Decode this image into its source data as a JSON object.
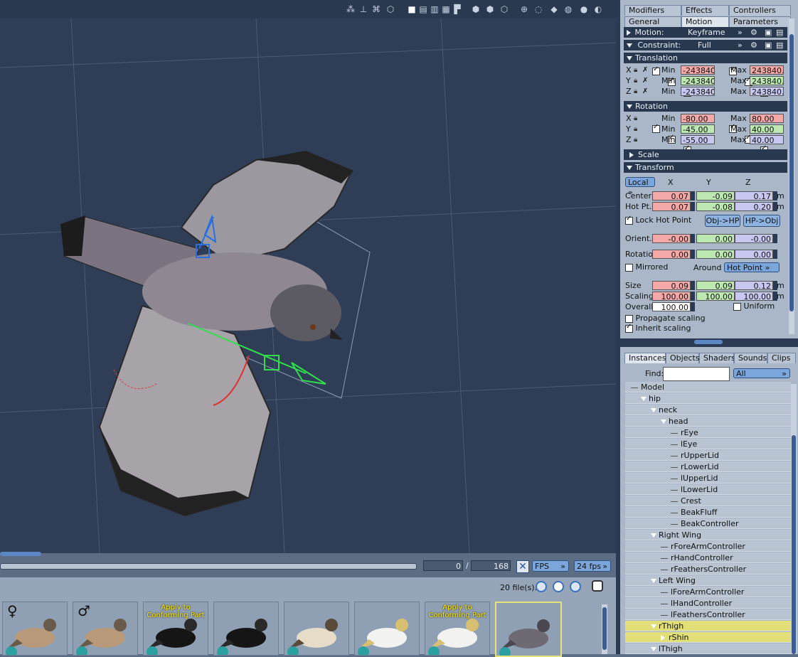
{
  "viewport": {
    "toolbar_icons": [
      "joint-icon",
      "sliders-icon",
      "wire-icon",
      "hexagon-icon",
      "single-view-icon",
      "two-view-icon",
      "three-view-icon",
      "four-view-icon",
      "corner-view-icon",
      "cube-wire-icon",
      "cube-shaded-icon",
      "cube-outline-icon",
      "move-icon",
      "dotted-sphere-icon",
      "box-icon",
      "gray-sphere-icon",
      "shaded-sphere-icon"
    ]
  },
  "params": {
    "top_tabs": [
      "Modifiers",
      "Effects",
      "Controllers"
    ],
    "sub_tabs": [
      "General",
      "Motion",
      "Parameters"
    ],
    "motion": {
      "label": "Motion:",
      "value": "Keyframe"
    },
    "constraint": {
      "label": "Constraint:",
      "value": "Full"
    },
    "translation": {
      "title": "Translation",
      "rows": [
        {
          "axis": "X",
          "min_label": "Min",
          "min": "-243840.",
          "max_label": "Max",
          "max": "243840.0"
        },
        {
          "axis": "Y",
          "min_label": "Min",
          "min": "-243840.",
          "max_label": "Max",
          "max": "243840.0"
        },
        {
          "axis": "Z",
          "min_label": "Min",
          "min": "-243840.",
          "max_label": "Max",
          "max": "243840.0"
        }
      ]
    },
    "rotation": {
      "title": "Rotation",
      "rows": [
        {
          "axis": "X",
          "min_label": "Min",
          "min": "-80.00",
          "max_label": "Max",
          "max": "80.00"
        },
        {
          "axis": "Y",
          "min_label": "Min",
          "min": "-45.00",
          "max_label": "Max",
          "max": "40.00"
        },
        {
          "axis": "Z",
          "min_label": "Min",
          "min": "-55.00",
          "max_label": "Max",
          "max": "40.00"
        }
      ]
    },
    "scale_title": "Scale",
    "transform": {
      "title": "Transform",
      "space": "Local",
      "col_x": "X",
      "col_y": "Y",
      "col_z": "Z",
      "center": {
        "label": "Center",
        "x": "0.07",
        "y": "-0.09",
        "z": "0.17",
        "unit": "m"
      },
      "hotpt": {
        "label": "Hot Pt.",
        "x": "0.07",
        "y": "-0.08",
        "z": "0.20",
        "unit": "m"
      },
      "lock_hot_point": "Lock Hot Point",
      "obj_hp": "Obj->HP",
      "hp_obj": "HP->Obj",
      "orient": {
        "label": "Orient.",
        "x": "-0.00",
        "y": "0.00",
        "z": "-0.00"
      },
      "rotation": {
        "label": "Rotation",
        "x": "0.00",
        "y": "0.00",
        "z": "0.00"
      },
      "mirrored": "Mirrored",
      "around_label": "Around",
      "around": "Hot Point",
      "size": {
        "label": "Size",
        "x": "0.09",
        "y": "0.09",
        "z": "0.12",
        "unit": "m"
      },
      "scaling": {
        "label": "Scaling",
        "x": "100.00",
        "y": "100.00",
        "z": "100.00",
        "unit": "m"
      },
      "overall": {
        "label": "Overall",
        "value": "100.00"
      },
      "uniform": "Uniform",
      "propagate": "Propagate scaling",
      "inherit": "Inherit scaling"
    }
  },
  "library": {
    "tabs": [
      "Instances",
      "Objects",
      "Shaders",
      "Sounds",
      "Clips"
    ],
    "find_label": "Find:",
    "find_value": "",
    "filter": "All",
    "tree": [
      {
        "label": "Model",
        "indent": 0,
        "open": false
      },
      {
        "label": "hip",
        "indent": 1,
        "open": true
      },
      {
        "label": "neck",
        "indent": 2,
        "open": true
      },
      {
        "label": "head",
        "indent": 3,
        "open": true
      },
      {
        "label": "rEye",
        "indent": 4
      },
      {
        "label": "lEye",
        "indent": 4
      },
      {
        "label": "rUpperLid",
        "indent": 4
      },
      {
        "label": "rLowerLid",
        "indent": 4
      },
      {
        "label": "lUpperLid",
        "indent": 4
      },
      {
        "label": "lLowerLid",
        "indent": 4
      },
      {
        "label": "Crest",
        "indent": 4
      },
      {
        "label": "BeakFluff",
        "indent": 4
      },
      {
        "label": "BeakController",
        "indent": 4
      },
      {
        "label": "Right Wing",
        "indent": 2,
        "open": true
      },
      {
        "label": "rForeArmController",
        "indent": 3
      },
      {
        "label": "rHandController",
        "indent": 3
      },
      {
        "label": "rFeathersController",
        "indent": 3
      },
      {
        "label": "Left Wing",
        "indent": 2,
        "open": true
      },
      {
        "label": "lForeArmController",
        "indent": 3
      },
      {
        "label": "lHandController",
        "indent": 3
      },
      {
        "label": "lFeathersController",
        "indent": 3
      },
      {
        "label": "rThigh",
        "indent": 2,
        "open": true,
        "selected": true
      },
      {
        "label": "rShin",
        "indent": 3,
        "closed": true,
        "selected": true
      },
      {
        "label": "lThigh",
        "indent": 2,
        "open": true
      }
    ]
  },
  "timeline": {
    "frame": "0",
    "separator": "/",
    "total": "168",
    "fps_mode": "FPS",
    "fps": "24 fps"
  },
  "content": {
    "file_count": "20 file(s).",
    "thumbs": [
      {
        "symbol": "♀",
        "apply": "",
        "bird": "quail"
      },
      {
        "symbol": "♂",
        "apply": "",
        "bird": "quail"
      },
      {
        "symbol": "",
        "apply": "Apply to Conforming Part",
        "bird": "crow"
      },
      {
        "symbol": "",
        "apply": "",
        "bird": "crow"
      },
      {
        "symbol": "",
        "apply": "",
        "bird": "kookaburra"
      },
      {
        "symbol": "",
        "apply": "",
        "bird": "cockatoo"
      },
      {
        "symbol": "",
        "apply": "Apply to Conforming Part",
        "bird": "cockatoo"
      },
      {
        "symbol": "",
        "apply": "",
        "bird": "pigeon"
      }
    ]
  },
  "colors": {
    "accent": "#3b5d91",
    "selected": "#e2de78",
    "x_field": "#f5a8a8",
    "y_field": "#bde8b2",
    "z_field": "#c7c7f0"
  }
}
